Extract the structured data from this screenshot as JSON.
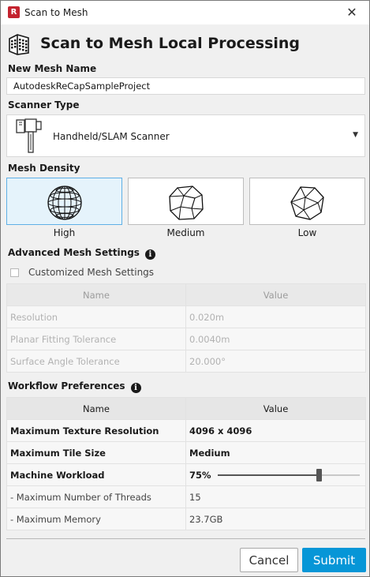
{
  "window": {
    "title": "Scan to Mesh",
    "app_icon_letter": "R",
    "close_label": "✕"
  },
  "header": {
    "title": "Scan to Mesh Local Processing",
    "icon": "building-grid-icon"
  },
  "mesh_name": {
    "label": "New Mesh Name",
    "value": "AutodeskReCapSampleProject"
  },
  "scanner_type": {
    "label": "Scanner Type",
    "selected": "Handheld/SLAM Scanner",
    "icon": "handheld-scanner-icon"
  },
  "mesh_density": {
    "label": "Mesh Density",
    "options": [
      {
        "label": "High",
        "selected": true,
        "icon": "high-density-sphere-icon"
      },
      {
        "label": "Medium",
        "selected": false,
        "icon": "medium-density-polyhedron-icon"
      },
      {
        "label": "Low",
        "selected": false,
        "icon": "low-density-polyhedron-icon"
      }
    ]
  },
  "advanced": {
    "label": "Advanced Mesh Settings",
    "info_icon": "i",
    "checkbox_label": "Customized Mesh Settings",
    "checked": false,
    "headers": [
      "Name",
      "Value"
    ],
    "rows": [
      {
        "name": "Resolution",
        "value": "0.020m"
      },
      {
        "name": "Planar Fitting Tolerance",
        "value": "0.0040m"
      },
      {
        "name": "Surface Angle Tolerance",
        "value": "20.000°"
      }
    ]
  },
  "workflow": {
    "label": "Workflow Preferences",
    "info_icon": "i",
    "headers": [
      "Name",
      "Value"
    ],
    "rows": [
      {
        "name": "Maximum Texture Resolution",
        "value": "4096 x 4096"
      },
      {
        "name": "Maximum Tile Size",
        "value": "Medium"
      },
      {
        "name": "Machine Workload",
        "value": "75%",
        "slider_fraction": 0.71
      },
      {
        "name": "- Maximum Number of Threads",
        "value": "15"
      },
      {
        "name": "- Maximum Memory",
        "value": "23.7GB"
      }
    ]
  },
  "buttons": {
    "cancel": "Cancel",
    "submit": "Submit"
  },
  "colors": {
    "accent": "#0696d7",
    "selected_tile_bg": "#e5f3fb",
    "selected_tile_border": "#5fb0e6",
    "app_icon": "#c4232f"
  }
}
